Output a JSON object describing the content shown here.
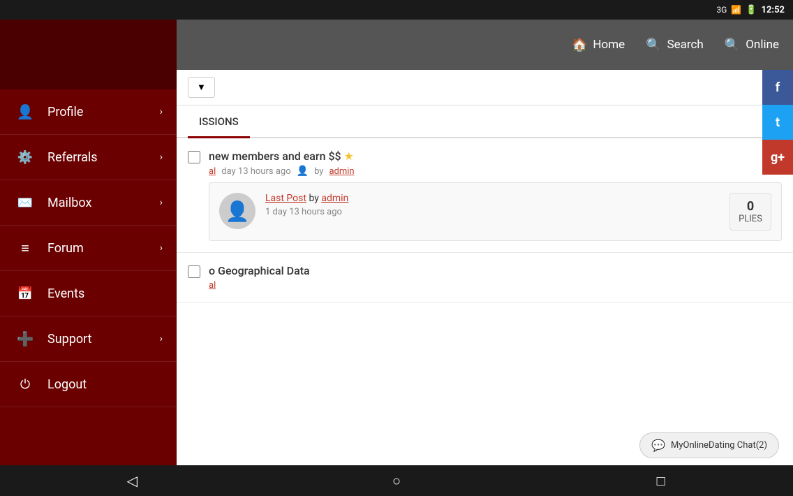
{
  "statusBar": {
    "network": "3G",
    "time": "12:52",
    "batteryIcon": "🔋"
  },
  "topNav": {
    "homeLabel": "Home",
    "searchLabel": "Search",
    "onlineLabel": "Online"
  },
  "sidebar": {
    "items": [
      {
        "id": "profile",
        "label": "Profile",
        "icon": "👤",
        "hasChevron": true
      },
      {
        "id": "referrals",
        "label": "Referrals",
        "icon": "⚙",
        "hasChevron": true
      },
      {
        "id": "mailbox",
        "label": "Mailbox",
        "icon": "✉",
        "hasChevron": true
      },
      {
        "id": "forum",
        "label": "Forum",
        "icon": "≡",
        "hasChevron": true
      },
      {
        "id": "events",
        "label": "Events",
        "icon": "📅",
        "hasChevron": false
      },
      {
        "id": "support",
        "label": "Support",
        "icon": "➕",
        "hasChevron": true
      },
      {
        "id": "logout",
        "label": "Logout",
        "icon": "⏻",
        "hasChevron": false
      }
    ]
  },
  "social": {
    "facebookLabel": "f",
    "twitterLabel": "t",
    "googleLabel": "g+"
  },
  "content": {
    "dropdown": {
      "value": "▼"
    },
    "tabs": [
      {
        "label": "ISSIONS",
        "active": true
      }
    ],
    "posts": [
      {
        "title": "new members and earn $$",
        "hasStar": true,
        "category": "al",
        "meta": "day 13 hours ago",
        "author": "admin",
        "lastPost": {
          "authorLink": "admin",
          "linkLabel": "Last Post",
          "timeAgo": "1 day 13 hours ago"
        },
        "replies": "0",
        "repliesLabel": "PLIES"
      },
      {
        "title": "o Geographical Data",
        "hasStar": false,
        "category": "al",
        "meta": "",
        "author": "",
        "lastPost": null,
        "replies": "",
        "repliesLabel": ""
      }
    ]
  },
  "chat": {
    "label": "MyOnlineDating Chat(2)"
  },
  "bottomBar": {
    "backLabel": "◁",
    "homeLabel": "○",
    "recentLabel": "□"
  }
}
